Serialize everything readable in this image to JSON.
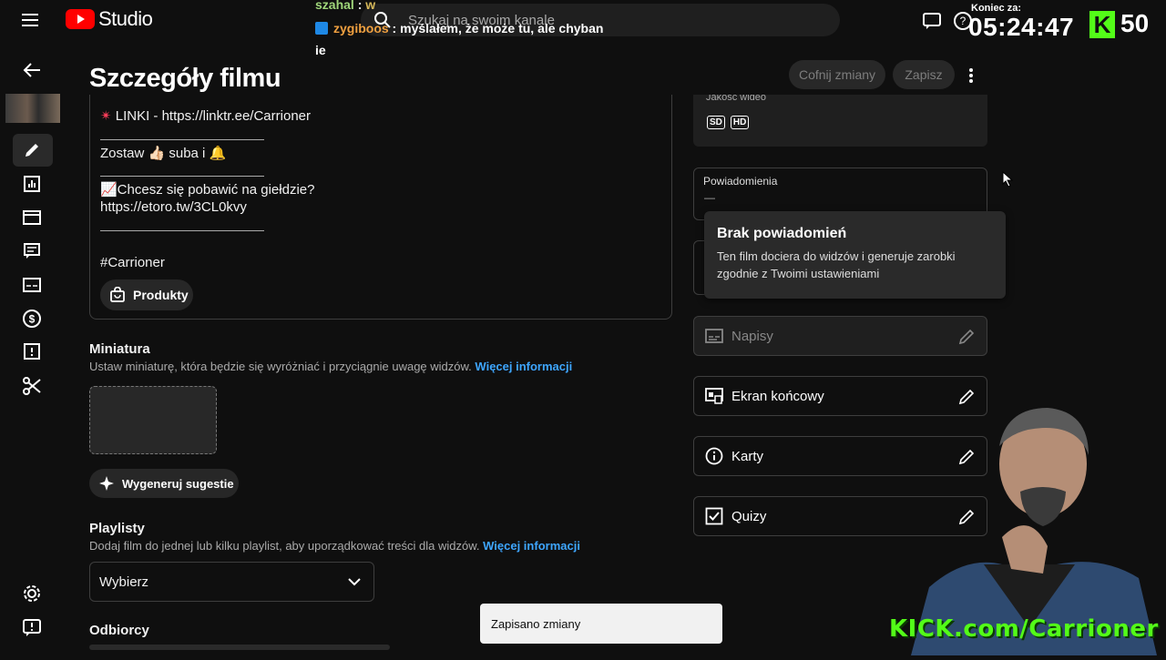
{
  "app": {
    "name": "Studio"
  },
  "search": {
    "placeholder": "Szukaj na swoim kanale"
  },
  "chat": {
    "line1": {
      "user": "szahal",
      "text": "w"
    },
    "line2": {
      "user": "zygiboos",
      "text": "myślałem, że może tu, ale chyban"
    },
    "line2_wrap": "ie"
  },
  "overlay": {
    "timer_label": "Koniec za:",
    "timer": "05:24:47",
    "k_badge": "K",
    "k_count": "50",
    "kick_url": "KICK.com/Carrioner"
  },
  "header": {
    "title": "Szczegóły filmu",
    "undo_label": "Cofnij zmiany",
    "save_label": "Zapisz"
  },
  "description": {
    "lines": {
      "links": "LINKI - https://linktr.ee/Carrioner",
      "sub": "Zostaw 👍🏻 suba i 🔔",
      "stocks": "📈Chcesz się pobawić na giełdzie?",
      "etoro": "https://etoro.tw/3CL0kvy",
      "tag": "#Carrioner"
    },
    "products_label": "Produkty"
  },
  "thumbnail": {
    "title": "Miniatura",
    "subtitle": "Ustaw miniaturę, która będzie się wyróżniać i przyciągnie uwagę widzów.",
    "more_link": "Więcej informacji",
    "generate_label": "Wygeneruj sugestie"
  },
  "playlists": {
    "title": "Playlisty",
    "subtitle": "Dodaj film do jednej lub kilku playlist, aby uporządkować treści dla widzów.",
    "more_link": "Więcej informacji",
    "select_value": "Wybierz"
  },
  "audience": {
    "title": "Odbiorcy"
  },
  "right_panel": {
    "quality_label": "Jakość wideo",
    "quality_badges": [
      "SD",
      "HD"
    ],
    "notifications_label": "Powiadomienia",
    "notifications_value": "—",
    "tooltip_title": "Brak powiadomień",
    "tooltip_body": "Ten film dociera do widzów i generuje zarobki zgodnie z Twoimi ustawieniami",
    "rows": {
      "subtitles": "Napisy",
      "end_screen": "Ekran końcowy",
      "cards": "Karty",
      "quizzes": "Quizy"
    }
  },
  "snackbar": {
    "text": "Zapisano zmiany"
  },
  "colors": {
    "background": "#0f0f0f",
    "accent_link": "#3ea6ff",
    "brand_red": "#ff0000",
    "kick_green": "#53fc18"
  },
  "icons": [
    "menu-icon",
    "youtube-logo-icon",
    "search-icon",
    "feedback-icon",
    "help-icon",
    "back-arrow-icon",
    "edit-icon",
    "analytics-icon",
    "content-icon",
    "comments-icon",
    "subtitles-icon",
    "monetization-icon",
    "copyright-icon",
    "editor-scissors-icon",
    "settings-icon",
    "send-feedback-icon",
    "shopping-bag-icon",
    "sparkle-icon",
    "chevron-down-icon",
    "pencil-icon",
    "end-screen-icon",
    "info-icon",
    "checkbox-icon"
  ]
}
